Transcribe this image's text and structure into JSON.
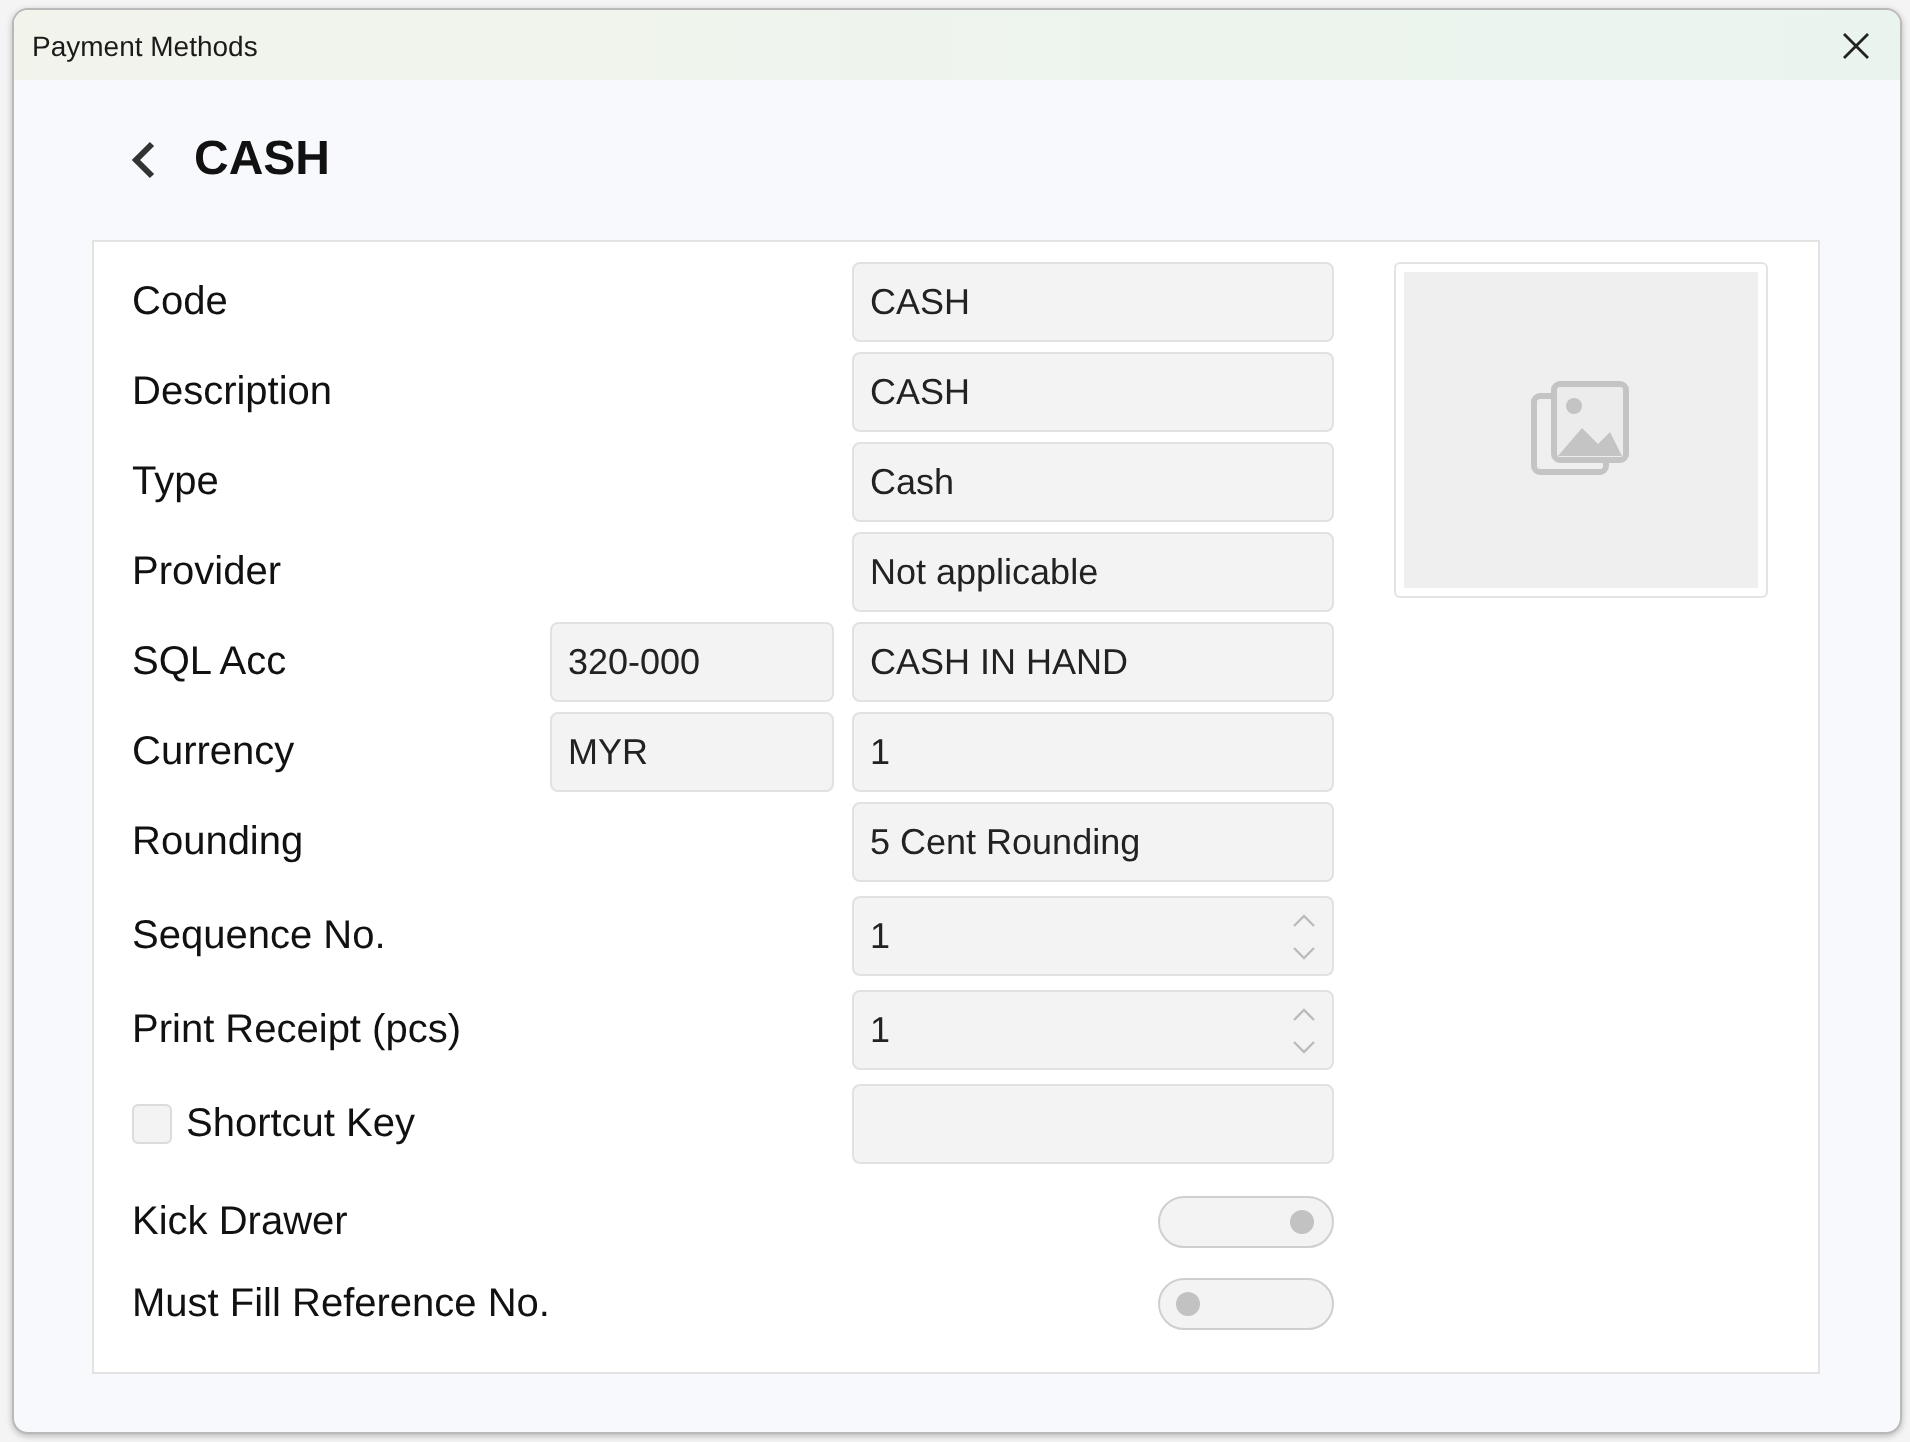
{
  "window": {
    "title": "Payment Methods"
  },
  "header": {
    "title": "CASH"
  },
  "fields": [
    {
      "kind": "text",
      "label": "Code",
      "value": "CASH"
    },
    {
      "kind": "text",
      "label": "Description",
      "value": "CASH"
    },
    {
      "kind": "text",
      "label": "Type",
      "value": "Cash"
    },
    {
      "kind": "text",
      "label": "Provider",
      "value": "Not applicable"
    },
    {
      "kind": "text",
      "label": "SQL Acc",
      "code": "320-000",
      "value": "CASH IN HAND"
    },
    {
      "kind": "text",
      "label": "Currency",
      "code": "MYR",
      "value": "1"
    },
    {
      "kind": "text",
      "label": "Rounding",
      "value": "5 Cent Rounding"
    },
    {
      "kind": "spinner",
      "label": "Sequence No.",
      "value": "1"
    },
    {
      "kind": "spinner",
      "label": "Print Receipt (pcs)",
      "value": "1"
    },
    {
      "kind": "checkbox",
      "label": "Shortcut Key",
      "checked": false
    },
    {
      "kind": "toggle",
      "label": "Kick Drawer",
      "on": true
    },
    {
      "kind": "toggle",
      "label": "Must Fill Reference No.",
      "on": false
    }
  ]
}
